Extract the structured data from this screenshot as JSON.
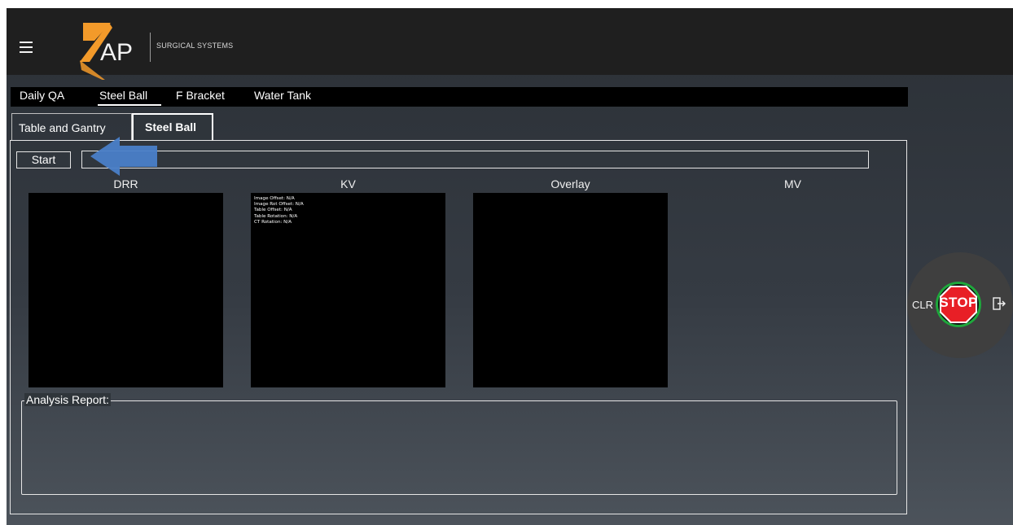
{
  "header": {
    "logo_text": "AP",
    "logo_subtitle": "SURGICAL SYSTEMS",
    "menu_icon": "hamburger-icon"
  },
  "topnav": {
    "items": [
      {
        "label": "Daily QA"
      },
      {
        "label": "Steel Ball"
      },
      {
        "label": "F Bracket"
      },
      {
        "label": "Water Tank"
      }
    ],
    "selected": "Steel Ball"
  },
  "subtabs": {
    "items": [
      {
        "label": "Table and Gantry"
      },
      {
        "label": "Steel Ball"
      }
    ],
    "active": "Steel Ball"
  },
  "toolbar": {
    "start_label": "Start",
    "status_value": ""
  },
  "columns": {
    "drr": "DRR",
    "kv": "KV",
    "overlay": "Overlay",
    "mv": "MV"
  },
  "kv_info": [
    "Image Offset: N/A",
    "Image Rot Offset: N/A",
    "Table Offset: N/A",
    "Table Rotation: N/A",
    "CT Rotation: N/A"
  ],
  "report": {
    "label": "Analysis Report:"
  },
  "controls": {
    "clr_label": "CLR",
    "stop_label": "STOP",
    "exit_icon": "exit-icon"
  },
  "colors": {
    "logo_orange": "#f39a2a",
    "stop_red": "#e81f26",
    "stop_ring_green": "#1ea83c",
    "annotation_arrow_blue": "#4a7fc8",
    "header_bg": "#1f1f1f"
  }
}
